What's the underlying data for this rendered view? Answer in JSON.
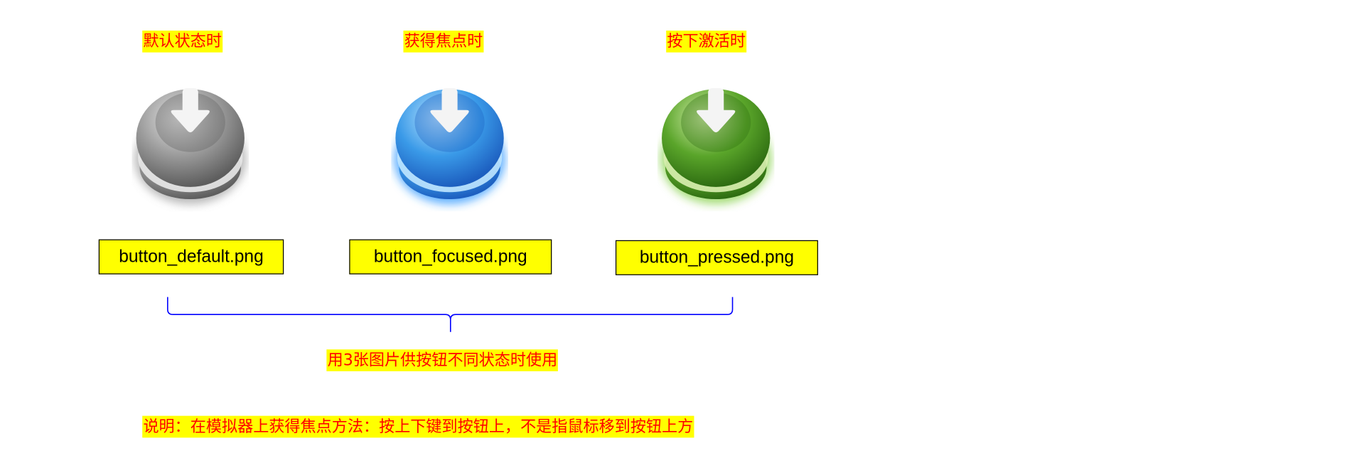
{
  "states": [
    {
      "label": "默认状态时",
      "file": "button_default.png",
      "color": "#9a9a9a",
      "light": "#e8e8e8",
      "dark": "#5e5e5e",
      "glow": "rgba(120,120,120,0.5)"
    },
    {
      "label": "获得焦点时",
      "file": "button_focused.png",
      "color": "#3a9ae8",
      "light": "#bfe6ff",
      "dark": "#1d5fc0",
      "glow": "rgba(40,150,255,0.7)"
    },
    {
      "label": "按下激活时",
      "file": "button_pressed.png",
      "color": "#5aa52a",
      "light": "#d9f0b0",
      "dark": "#2f6e12",
      "glow": "rgba(110,200,40,0.6)"
    }
  ],
  "brace_caption": "用3张图片供按钮不同状态时使用",
  "note": "说明：在模拟器上获得焦点方法：按上下键到按钮上，不是指鼠标移到按钮上方",
  "brace_color": "#0000ff",
  "icon": "down-arrow-icon"
}
